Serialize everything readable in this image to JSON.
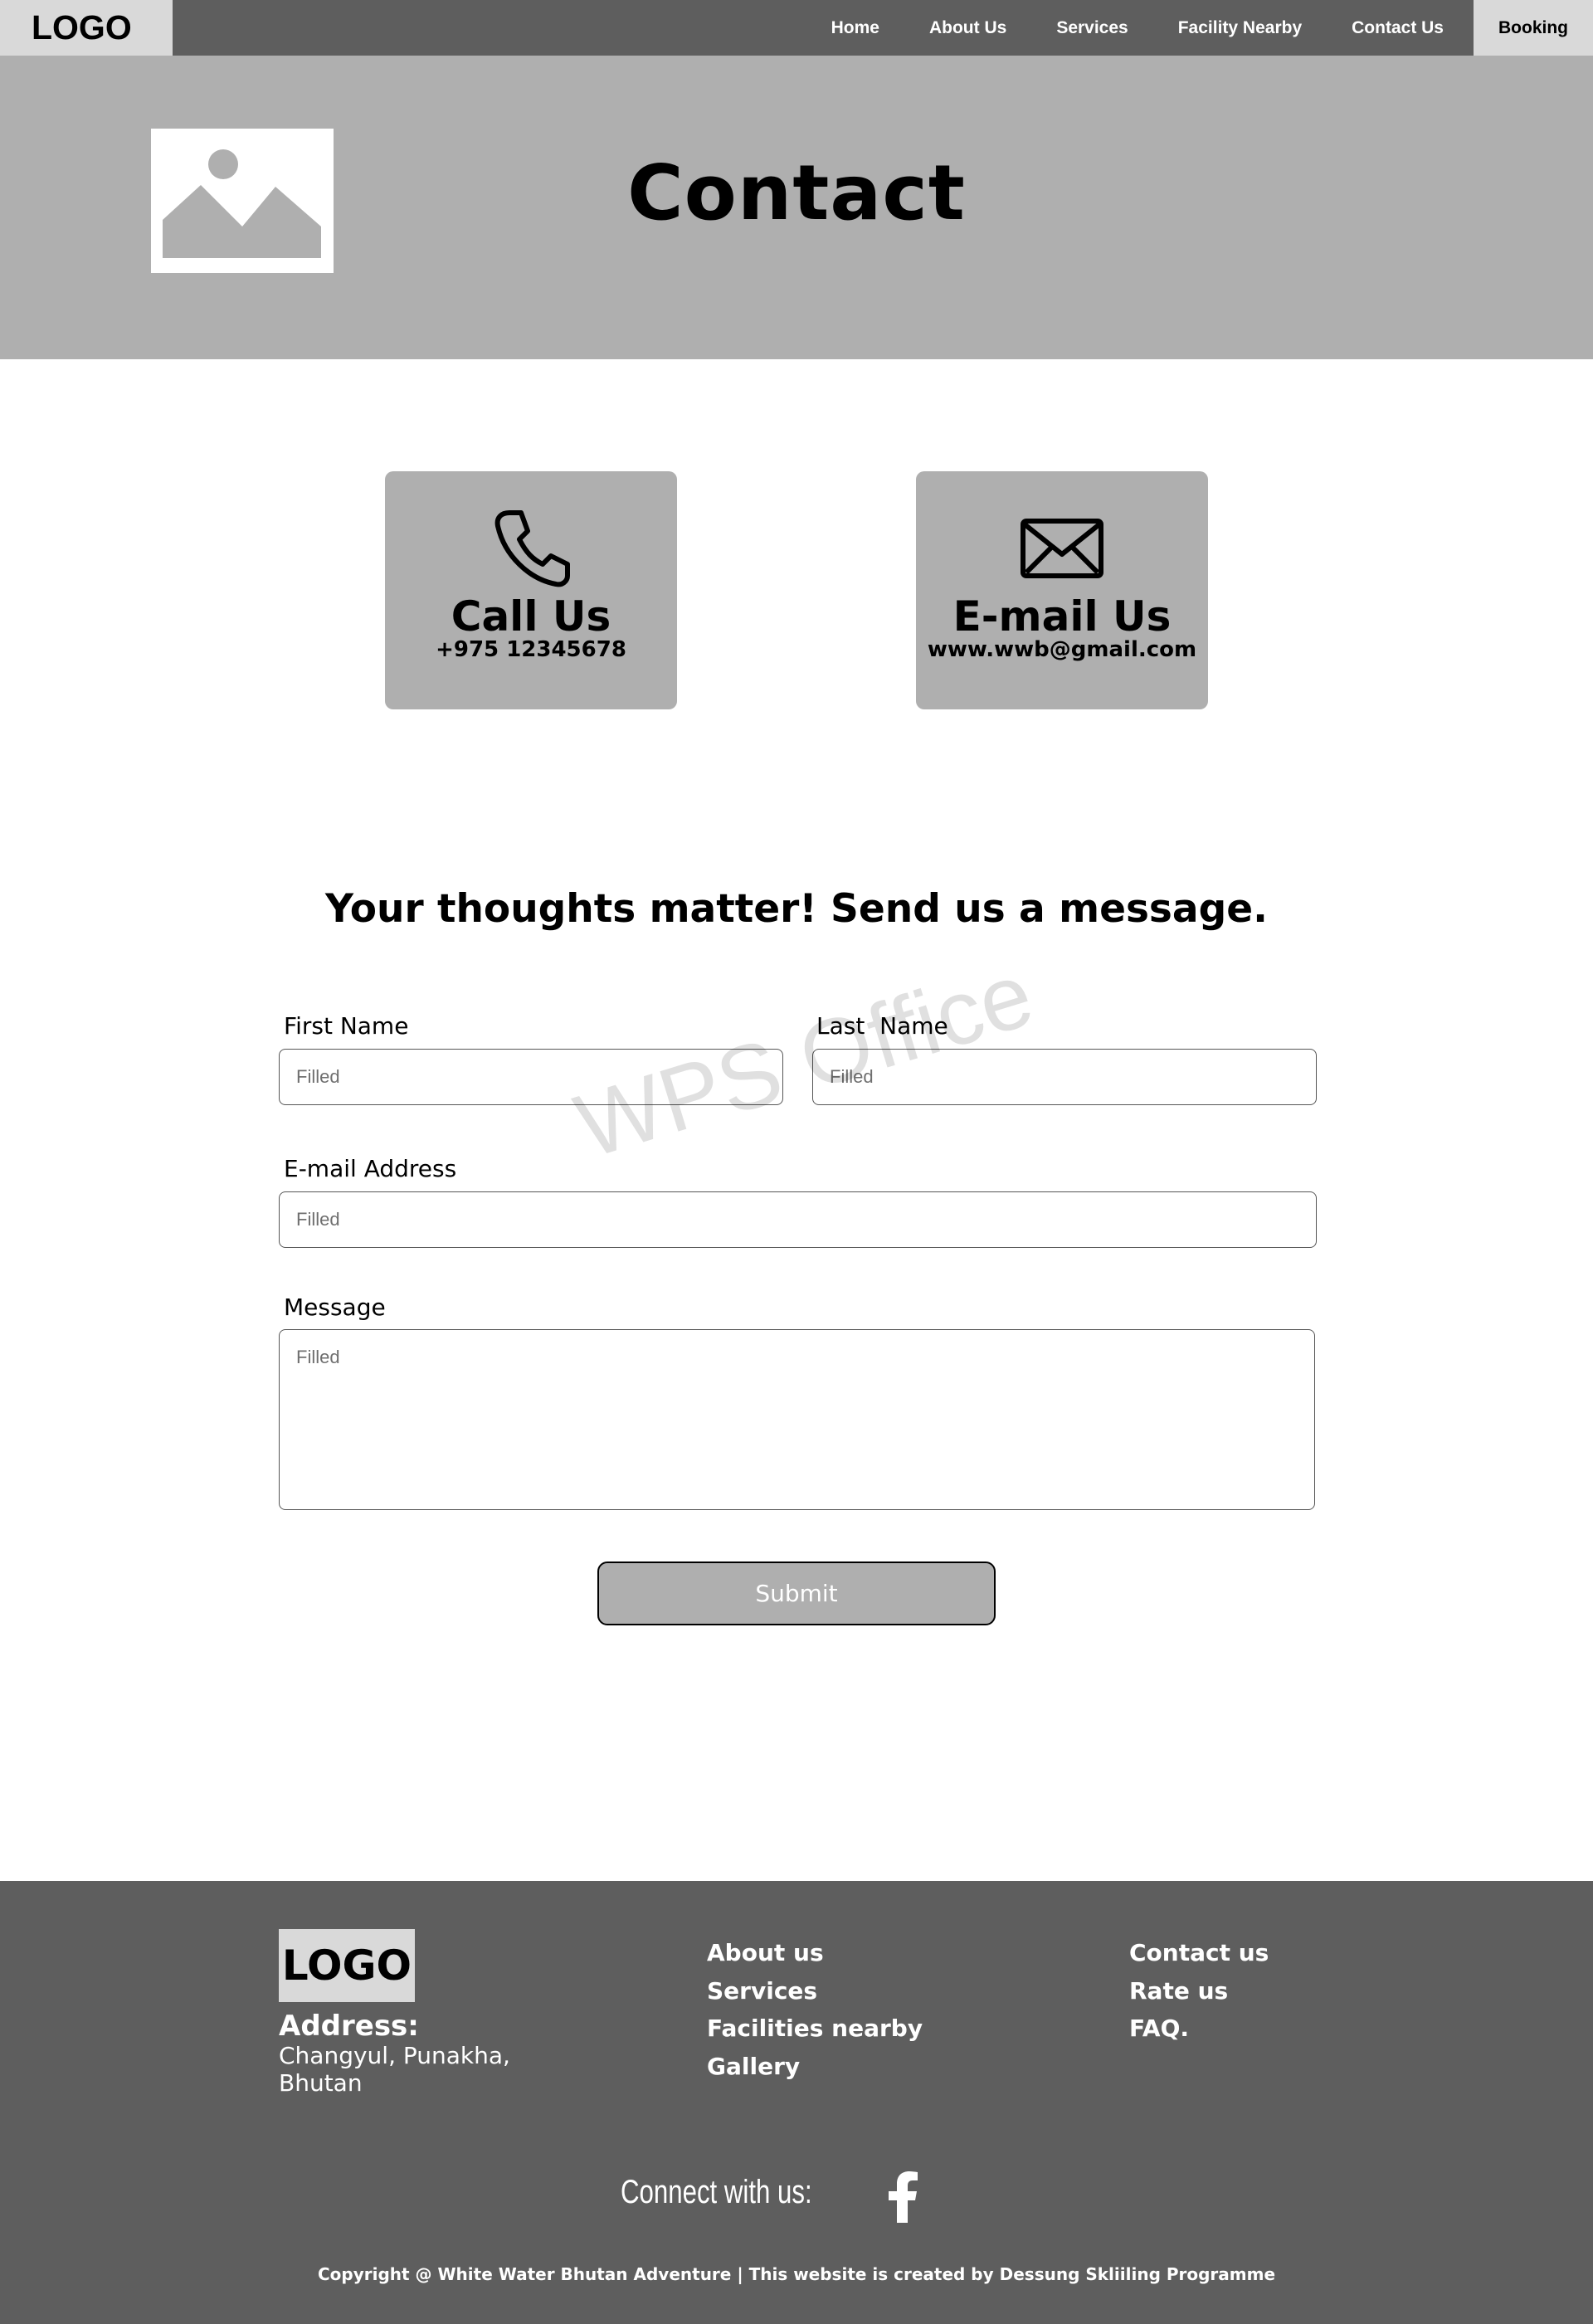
{
  "nav": {
    "logo": "LOGO",
    "links": [
      "Home",
      "About Us",
      "Services",
      "Facility Nearby",
      "Contact Us"
    ],
    "booking": "Booking"
  },
  "hero": {
    "title": "Contact",
    "image_icon": "image-placeholder-icon"
  },
  "cards": {
    "phone": {
      "icon": "phone-icon",
      "title": "Call Us",
      "value": "+975 12345678"
    },
    "email": {
      "icon": "envelope-icon",
      "title": "E-mail Us",
      "value": "www.wwb@gmail.com"
    }
  },
  "form": {
    "heading": "Your thoughts matter! Send us a message.",
    "first_name": {
      "label": "First Name",
      "value": "Filled"
    },
    "last_name": {
      "label": "Last  Name",
      "value": "Filled"
    },
    "email": {
      "label": "E-mail Address",
      "value": "Filled"
    },
    "message": {
      "label": "Message",
      "value": "Filled"
    },
    "submit": "Submit"
  },
  "watermark": "WPS Office",
  "footer": {
    "logo": "LOGO",
    "address_label": "Address:",
    "address": "Changyul, Punakha, Bhutan",
    "col1": [
      "About us",
      "Services",
      "Facilities nearby",
      "Gallery"
    ],
    "col2": [
      "Contact us",
      "Rate us",
      "FAQ."
    ],
    "connect": "Connect with us:",
    "social_icon": "facebook-icon",
    "copyright": "Copyright @ White Water Bhutan Adventure | This website is created by Dessung Skliiling Programme"
  },
  "colors": {
    "nav_bg": "#5e5e5e",
    "logo_bg": "#d9d9d9",
    "hero_bg": "#afafaf",
    "card_bg": "#afafaf",
    "footer_bg": "#5e5e5e"
  }
}
